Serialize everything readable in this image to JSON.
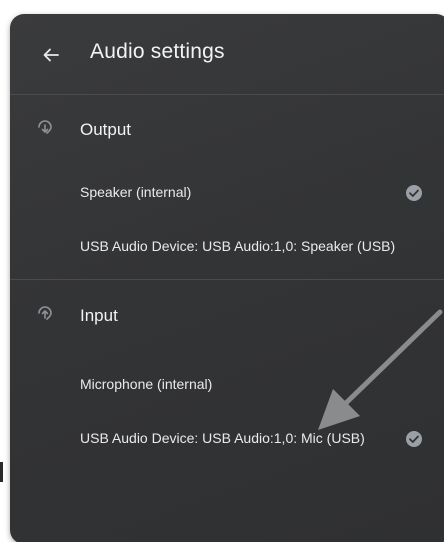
{
  "header": {
    "title": "Audio settings",
    "back_icon": "arrow-back-icon"
  },
  "output": {
    "label": "Output",
    "icon": "output-icon",
    "devices": [
      {
        "label": "Speaker (internal)",
        "selected": true
      },
      {
        "label": "USB Audio Device: USB Audio:1,0: Speaker (USB)",
        "selected": false
      }
    ]
  },
  "input": {
    "label": "Input",
    "icon": "input-icon",
    "devices": [
      {
        "label": "Microphone (internal)",
        "selected": false
      },
      {
        "label": "USB Audio Device: USB Audio:1,0: Mic (USB)",
        "selected": true
      }
    ]
  },
  "colors": {
    "panel_bg": "#333436",
    "text": "#e8eaed",
    "check": "#9aa0a6",
    "annotation_arrow": "#8a8b8d"
  }
}
